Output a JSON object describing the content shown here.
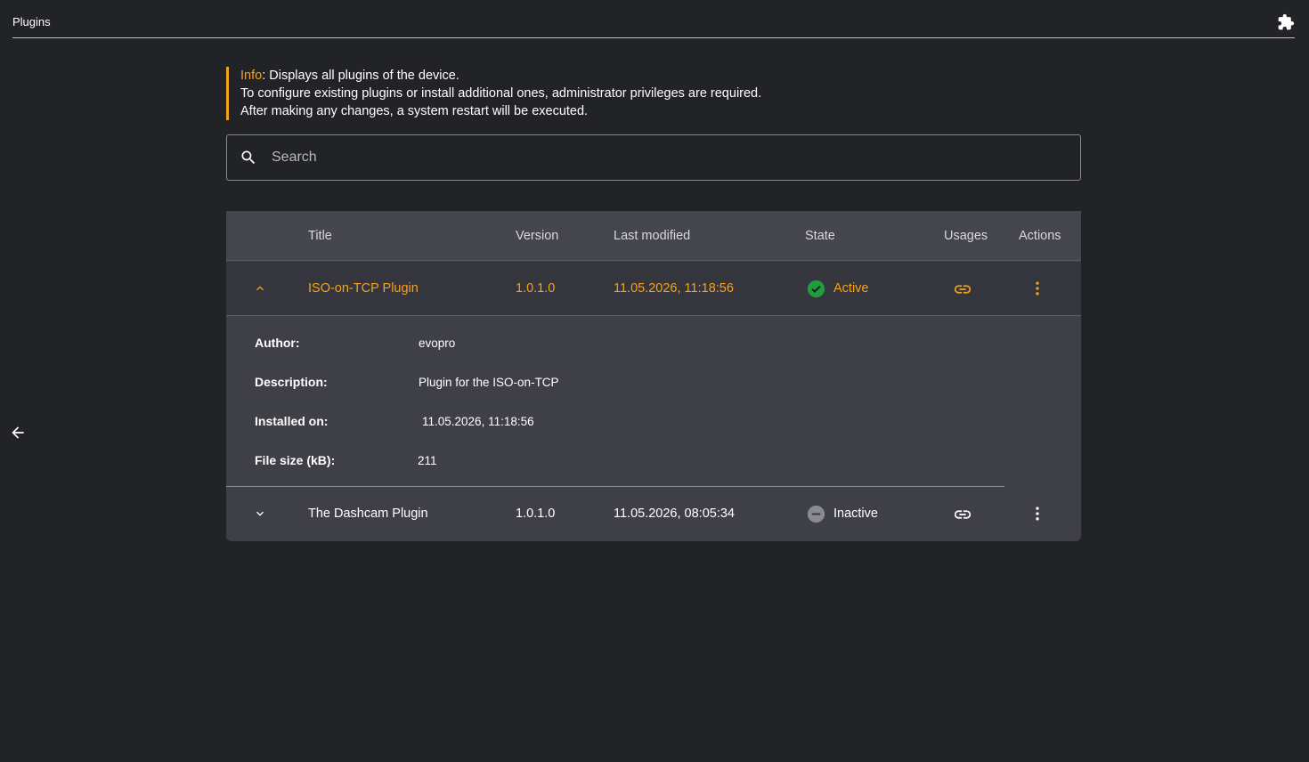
{
  "header": {
    "title": "Plugins",
    "icon": "puzzle-icon"
  },
  "info": {
    "label": "Info",
    "line1": ": Displays all plugins of the device.",
    "line2": "To configure existing plugins or install additional ones, administrator privileges are required.",
    "line3": "After making any changes, a system restart will be executed."
  },
  "search": {
    "placeholder": "Search",
    "value": ""
  },
  "table": {
    "columns": {
      "title": "Title",
      "version": "Version",
      "last_modified": "Last modified",
      "state": "State",
      "usages": "Usages",
      "actions": "Actions"
    },
    "rows": [
      {
        "title": "ISO-on-TCP Plugin",
        "version": "1.0.1.0",
        "last_modified": "11.05.2026, 11:18:56",
        "state": "Active",
        "expanded": true,
        "details": {
          "author_label": "Author:",
          "author": "evopro",
          "description_label": "Description:",
          "description": "Plugin for the ISO-on-TCP",
          "installed_label": "Installed on:",
          "installed": "11.05.2026, 11:18:56",
          "filesize_label": "File size (kB):",
          "filesize": "211"
        }
      },
      {
        "title": "The Dashcam Plugin",
        "version": "1.0.1.0",
        "last_modified": "11.05.2026, 08:05:34",
        "state": "Inactive",
        "expanded": false
      }
    ]
  },
  "colors": {
    "background": "#222327",
    "accent": "#f5a11a",
    "active": "#1e9e3a",
    "inactive": "#8a8b90"
  }
}
